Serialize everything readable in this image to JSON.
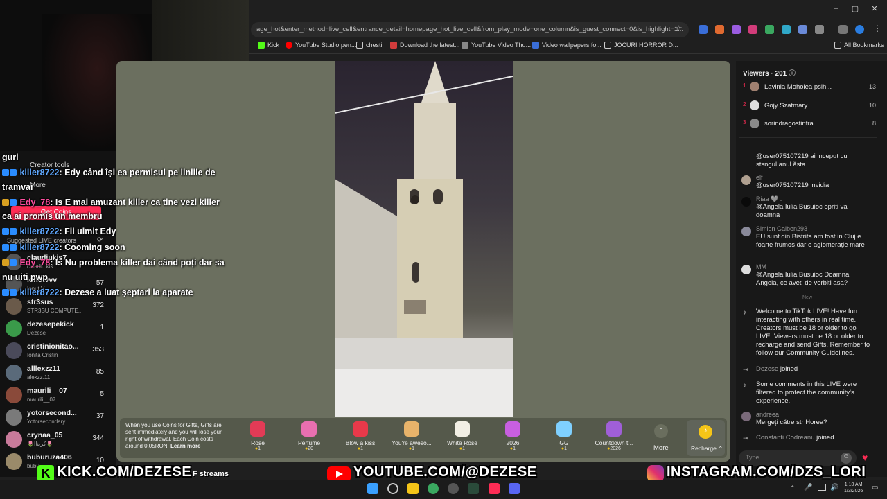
{
  "browser": {
    "url": "age_hot&enter_method=live_cell&entrance_detail=homepage_hot_live_cell&from_play_mode=one_column&is_guest_connect=0&is_highlight=1...",
    "window_controls": [
      "–",
      "▢",
      "✕"
    ],
    "bookmarks": [
      {
        "label": "Kick",
        "icon": "kick-icon"
      },
      {
        "label": "YouTube Studio pen...",
        "icon": "youtube-icon"
      },
      {
        "label": "chesti",
        "icon": "folder-icon"
      },
      {
        "label": "Download the latest...",
        "icon": "download-icon"
      },
      {
        "label": "YouTube Video Thu...",
        "icon": "youtube-icon"
      },
      {
        "label": "Video wallpapers fo...",
        "icon": "vimeo-icon"
      },
      {
        "label": "JOCURI HORROR D...",
        "icon": "folder-icon"
      }
    ],
    "all_bookmarks": "All Bookmarks"
  },
  "left_nav": {
    "creator_tools": "Creator tools",
    "more": "More",
    "get_coins": "Get Coins",
    "suggested_title": "Suggested LIVE creators",
    "creators": [
      {
        "name": "claudiukis7",
        "sub": "claudiu kis",
        "count": ""
      },
      {
        "name": "ionotvvv",
        "sub": "Ionut V",
        "count": "57"
      },
      {
        "name": "str3sus",
        "sub": "STR3SU COMPUTE...",
        "count": "372"
      },
      {
        "name": "dezesepekick",
        "sub": "Dezese",
        "count": "1"
      },
      {
        "name": "cristinionitao...",
        "sub": "Ionita Cristin",
        "count": "353"
      },
      {
        "name": "alllexzz11",
        "sub": "alexzz.11_",
        "count": "85"
      },
      {
        "name": "maurili__07",
        "sub": "maurili__07",
        "count": "5"
      },
      {
        "name": "yotorsecond...",
        "sub": "Yotorsecondary",
        "count": "37"
      },
      {
        "name": "crynaa_05",
        "sub": "🌷كريناا🌷",
        "count": "344"
      },
      {
        "name": "buburuza406",
        "sub": "bubu",
        "count": "10"
      }
    ],
    "streams_label": "F streams"
  },
  "chat_overlay": [
    {
      "user": "",
      "text": "guri"
    },
    {
      "user": "killer8722",
      "text": ": Edy când își ea permisul pe liniile de"
    },
    {
      "user": "",
      "text": "tramvai"
    },
    {
      "user": "Edy_78",
      "text": ": Is E mai amuzant killer ca tine vezi killer"
    },
    {
      "user": "",
      "text": "ca ai promis un membru"
    },
    {
      "user": "killer8722",
      "text": ": Fii uimit Edy"
    },
    {
      "user": "killer8722",
      "text": ": Cooming soon"
    },
    {
      "user": "Edy_78",
      "text": ": Is Nu problema killer dai când poți dar sa"
    },
    {
      "user": "",
      "text": "nu uiti pwp"
    },
    {
      "user": "killer8722",
      "text": ": Dezese a luat șeptari la aparate"
    }
  ],
  "viewers": {
    "title": "Viewers · 201",
    "list": [
      {
        "rank": "1",
        "name": "Lavinia Moholea psih...",
        "count": "13"
      },
      {
        "rank": "2",
        "name": "Gojy Szatmary",
        "count": "10"
      },
      {
        "rank": "3",
        "name": "sorindragostinfra",
        "count": "8"
      }
    ]
  },
  "comments": [
    {
      "user": "",
      "text": "@user075107219 ai inceput cu stsngul anul ăsta"
    },
    {
      "user": "elf",
      "text": "@user075107219 invidia"
    },
    {
      "user": "Riaa 🩶 .",
      "text": "@Angela Iulia Busuioc opriti va doamna"
    },
    {
      "user": "Simion Galben293",
      "text": "EU sunt din Bistrita am fost in Cluj e foarte frumos dar e aglomerație mare"
    },
    {
      "user": "MM",
      "text": "@Angela Iulia Busuioc Doamna Angela, ce aveti de vorbiti asa?"
    }
  ],
  "new_label": "New",
  "system_messages": {
    "welcome": "Welcome to TikTok LIVE! Have fun interacting with others in real time. Creators must be 18 or older to go LIVE. Viewers must be 18 or older to recharge and send Gifts. Remember to follow our Community Guidelines.",
    "joined1_user": "Dezese",
    "joined_word": "joined",
    "filtered": "Some comments in this LIVE were filtered to protect the community's experience.",
    "andreea_user": "andreea",
    "andreea_text": "Mergeți către str Horea?",
    "joined2_user": "Constanti Codreanu"
  },
  "chat_input": {
    "placeholder": "Type..."
  },
  "gift_info": {
    "text": "When you use Coins for Gifts, Gifts are sent immediately and you will lose your right of withdrawal. Each Coin costs around 0.05RON.",
    "learn_more": "Learn more"
  },
  "gifts": [
    {
      "name": "Rose",
      "cost": "1",
      "color": "#e23b56"
    },
    {
      "name": "Perfume",
      "cost": "20",
      "color": "#e86fb0"
    },
    {
      "name": "Blow a kiss",
      "cost": "1",
      "color": "#e8394a"
    },
    {
      "name": "You're aweso...",
      "cost": "1",
      "color": "#e8b36a"
    },
    {
      "name": "White Rose",
      "cost": "1",
      "color": "#f2efe4"
    },
    {
      "name": "2026",
      "cost": "1",
      "color": "#c85fe0"
    },
    {
      "name": "GG",
      "cost": "1",
      "color": "#7fd0ff"
    },
    {
      "name": "Countdown t...",
      "cost": "2026",
      "color": "#a05fd8"
    }
  ],
  "gift_more": "More",
  "recharge": "Recharge",
  "banners": {
    "kick": "KICK.COM/DEZESE",
    "youtube": "YOUTUBE.COM/@DEZESE",
    "instagram": "INSTAGRAM.COM/DZS_LORI"
  },
  "taskbar": {
    "time": "1:10 AM",
    "date": "1/3/2026"
  }
}
